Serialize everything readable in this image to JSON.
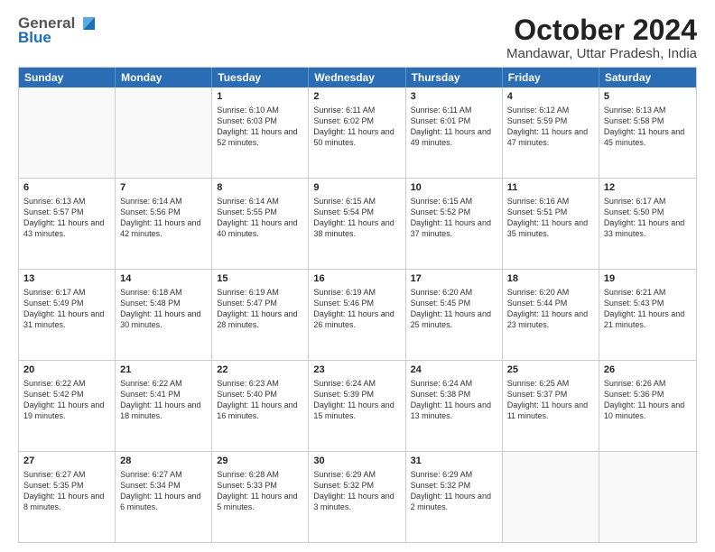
{
  "logo": {
    "line1": "General",
    "line2": "Blue"
  },
  "title": "October 2024",
  "subtitle": "Mandawar, Uttar Pradesh, India",
  "header_days": [
    "Sunday",
    "Monday",
    "Tuesday",
    "Wednesday",
    "Thursday",
    "Friday",
    "Saturday"
  ],
  "weeks": [
    [
      {
        "day": "",
        "sunrise": "",
        "sunset": "",
        "daylight": ""
      },
      {
        "day": "",
        "sunrise": "",
        "sunset": "",
        "daylight": ""
      },
      {
        "day": "1",
        "sunrise": "Sunrise: 6:10 AM",
        "sunset": "Sunset: 6:03 PM",
        "daylight": "Daylight: 11 hours and 52 minutes."
      },
      {
        "day": "2",
        "sunrise": "Sunrise: 6:11 AM",
        "sunset": "Sunset: 6:02 PM",
        "daylight": "Daylight: 11 hours and 50 minutes."
      },
      {
        "day": "3",
        "sunrise": "Sunrise: 6:11 AM",
        "sunset": "Sunset: 6:01 PM",
        "daylight": "Daylight: 11 hours and 49 minutes."
      },
      {
        "day": "4",
        "sunrise": "Sunrise: 6:12 AM",
        "sunset": "Sunset: 5:59 PM",
        "daylight": "Daylight: 11 hours and 47 minutes."
      },
      {
        "day": "5",
        "sunrise": "Sunrise: 6:13 AM",
        "sunset": "Sunset: 5:58 PM",
        "daylight": "Daylight: 11 hours and 45 minutes."
      }
    ],
    [
      {
        "day": "6",
        "sunrise": "Sunrise: 6:13 AM",
        "sunset": "Sunset: 5:57 PM",
        "daylight": "Daylight: 11 hours and 43 minutes."
      },
      {
        "day": "7",
        "sunrise": "Sunrise: 6:14 AM",
        "sunset": "Sunset: 5:56 PM",
        "daylight": "Daylight: 11 hours and 42 minutes."
      },
      {
        "day": "8",
        "sunrise": "Sunrise: 6:14 AM",
        "sunset": "Sunset: 5:55 PM",
        "daylight": "Daylight: 11 hours and 40 minutes."
      },
      {
        "day": "9",
        "sunrise": "Sunrise: 6:15 AM",
        "sunset": "Sunset: 5:54 PM",
        "daylight": "Daylight: 11 hours and 38 minutes."
      },
      {
        "day": "10",
        "sunrise": "Sunrise: 6:15 AM",
        "sunset": "Sunset: 5:52 PM",
        "daylight": "Daylight: 11 hours and 37 minutes."
      },
      {
        "day": "11",
        "sunrise": "Sunrise: 6:16 AM",
        "sunset": "Sunset: 5:51 PM",
        "daylight": "Daylight: 11 hours and 35 minutes."
      },
      {
        "day": "12",
        "sunrise": "Sunrise: 6:17 AM",
        "sunset": "Sunset: 5:50 PM",
        "daylight": "Daylight: 11 hours and 33 minutes."
      }
    ],
    [
      {
        "day": "13",
        "sunrise": "Sunrise: 6:17 AM",
        "sunset": "Sunset: 5:49 PM",
        "daylight": "Daylight: 11 hours and 31 minutes."
      },
      {
        "day": "14",
        "sunrise": "Sunrise: 6:18 AM",
        "sunset": "Sunset: 5:48 PM",
        "daylight": "Daylight: 11 hours and 30 minutes."
      },
      {
        "day": "15",
        "sunrise": "Sunrise: 6:19 AM",
        "sunset": "Sunset: 5:47 PM",
        "daylight": "Daylight: 11 hours and 28 minutes."
      },
      {
        "day": "16",
        "sunrise": "Sunrise: 6:19 AM",
        "sunset": "Sunset: 5:46 PM",
        "daylight": "Daylight: 11 hours and 26 minutes."
      },
      {
        "day": "17",
        "sunrise": "Sunrise: 6:20 AM",
        "sunset": "Sunset: 5:45 PM",
        "daylight": "Daylight: 11 hours and 25 minutes."
      },
      {
        "day": "18",
        "sunrise": "Sunrise: 6:20 AM",
        "sunset": "Sunset: 5:44 PM",
        "daylight": "Daylight: 11 hours and 23 minutes."
      },
      {
        "day": "19",
        "sunrise": "Sunrise: 6:21 AM",
        "sunset": "Sunset: 5:43 PM",
        "daylight": "Daylight: 11 hours and 21 minutes."
      }
    ],
    [
      {
        "day": "20",
        "sunrise": "Sunrise: 6:22 AM",
        "sunset": "Sunset: 5:42 PM",
        "daylight": "Daylight: 11 hours and 19 minutes."
      },
      {
        "day": "21",
        "sunrise": "Sunrise: 6:22 AM",
        "sunset": "Sunset: 5:41 PM",
        "daylight": "Daylight: 11 hours and 18 minutes."
      },
      {
        "day": "22",
        "sunrise": "Sunrise: 6:23 AM",
        "sunset": "Sunset: 5:40 PM",
        "daylight": "Daylight: 11 hours and 16 minutes."
      },
      {
        "day": "23",
        "sunrise": "Sunrise: 6:24 AM",
        "sunset": "Sunset: 5:39 PM",
        "daylight": "Daylight: 11 hours and 15 minutes."
      },
      {
        "day": "24",
        "sunrise": "Sunrise: 6:24 AM",
        "sunset": "Sunset: 5:38 PM",
        "daylight": "Daylight: 11 hours and 13 minutes."
      },
      {
        "day": "25",
        "sunrise": "Sunrise: 6:25 AM",
        "sunset": "Sunset: 5:37 PM",
        "daylight": "Daylight: 11 hours and 11 minutes."
      },
      {
        "day": "26",
        "sunrise": "Sunrise: 6:26 AM",
        "sunset": "Sunset: 5:36 PM",
        "daylight": "Daylight: 11 hours and 10 minutes."
      }
    ],
    [
      {
        "day": "27",
        "sunrise": "Sunrise: 6:27 AM",
        "sunset": "Sunset: 5:35 PM",
        "daylight": "Daylight: 11 hours and 8 minutes."
      },
      {
        "day": "28",
        "sunrise": "Sunrise: 6:27 AM",
        "sunset": "Sunset: 5:34 PM",
        "daylight": "Daylight: 11 hours and 6 minutes."
      },
      {
        "day": "29",
        "sunrise": "Sunrise: 6:28 AM",
        "sunset": "Sunset: 5:33 PM",
        "daylight": "Daylight: 11 hours and 5 minutes."
      },
      {
        "day": "30",
        "sunrise": "Sunrise: 6:29 AM",
        "sunset": "Sunset: 5:32 PM",
        "daylight": "Daylight: 11 hours and 3 minutes."
      },
      {
        "day": "31",
        "sunrise": "Sunrise: 6:29 AM",
        "sunset": "Sunset: 5:32 PM",
        "daylight": "Daylight: 11 hours and 2 minutes."
      },
      {
        "day": "",
        "sunrise": "",
        "sunset": "",
        "daylight": ""
      },
      {
        "day": "",
        "sunrise": "",
        "sunset": "",
        "daylight": ""
      }
    ]
  ]
}
